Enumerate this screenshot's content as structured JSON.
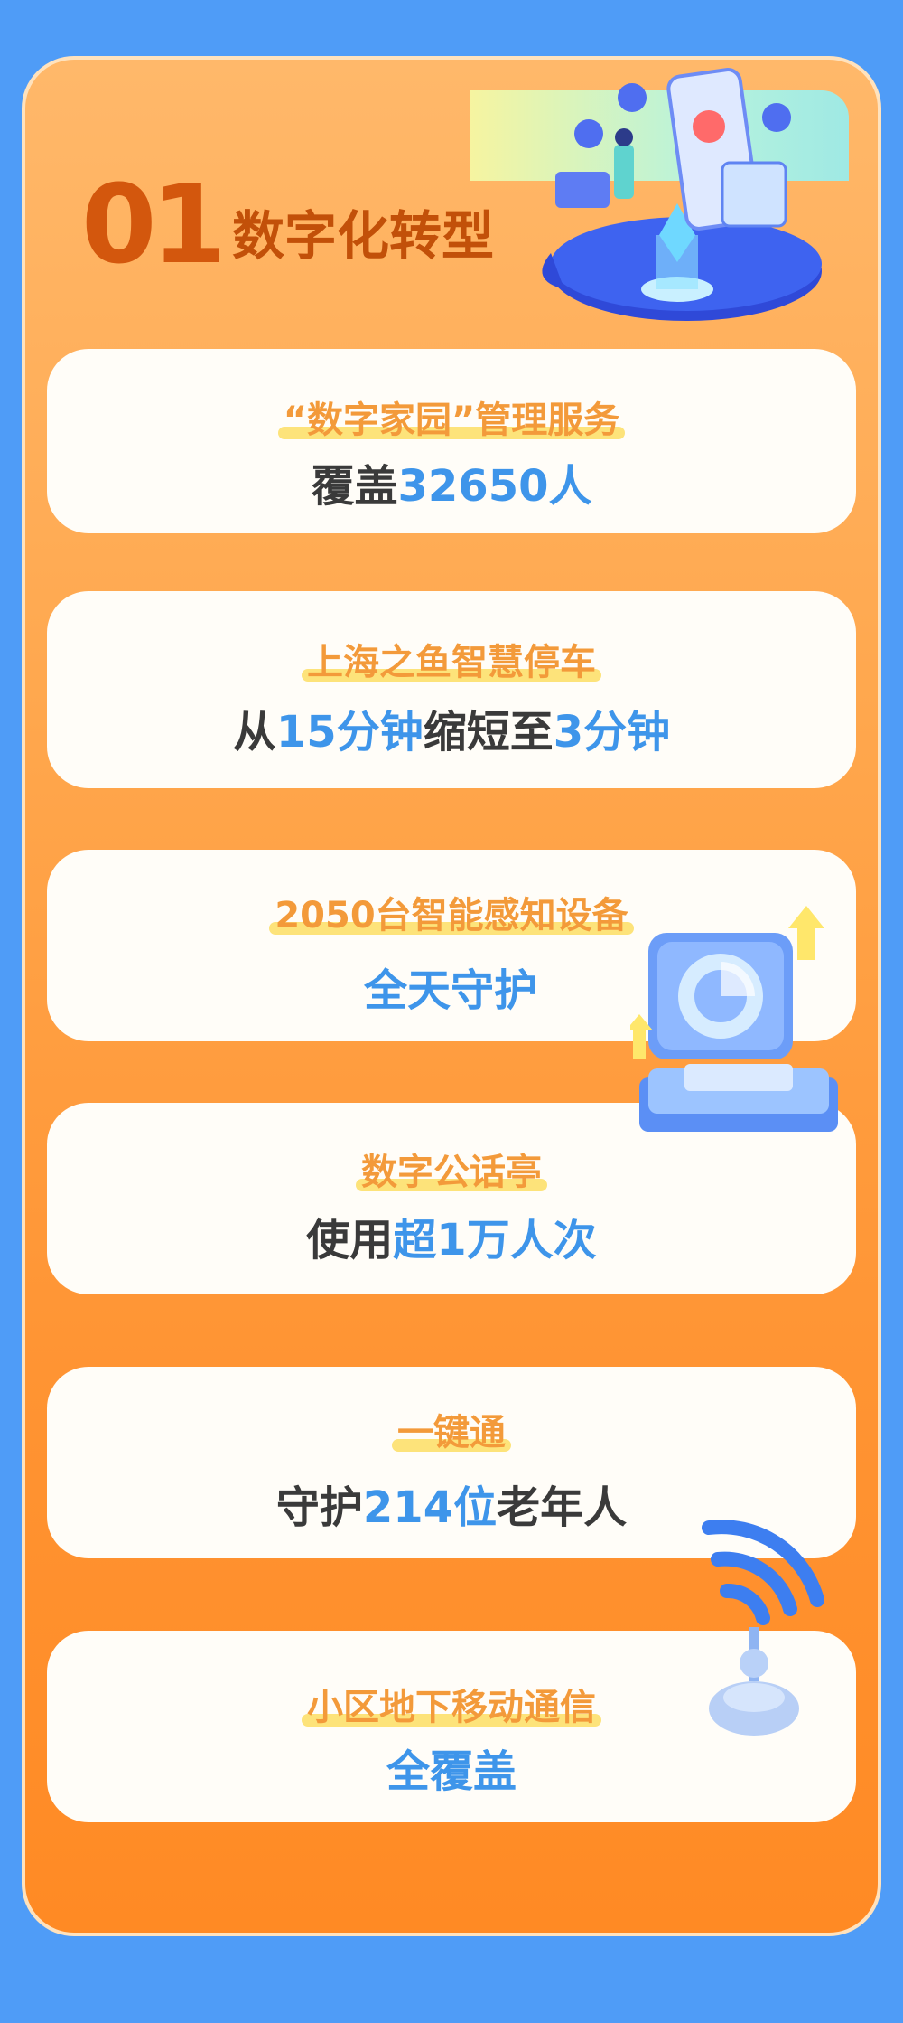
{
  "title": {
    "number": "01",
    "text": "数字化转型"
  },
  "cards": [
    {
      "head": "“数字家园”管理服务",
      "body": [
        {
          "t": "覆盖",
          "c": "dark"
        },
        {
          "t": "32650人",
          "c": "blue"
        }
      ]
    },
    {
      "head": "上海之鱼智慧停车",
      "body": [
        {
          "t": "从",
          "c": "dark"
        },
        {
          "t": "15分钟",
          "c": "blue"
        },
        {
          "t": "缩短至",
          "c": "dark"
        },
        {
          "t": "3分钟",
          "c": "blue"
        }
      ]
    },
    {
      "head": "2050台智能感知设备",
      "body": [
        {
          "t": "全天守护",
          "c": "blue"
        }
      ]
    },
    {
      "head": "数字公话亭",
      "body": [
        {
          "t": "使用",
          "c": "dark"
        },
        {
          "t": "超1万人次",
          "c": "blue"
        }
      ]
    },
    {
      "head": "一键通",
      "body": [
        {
          "t": "守护",
          "c": "dark"
        },
        {
          "t": "214位",
          "c": "blue"
        },
        {
          "t": "老年人",
          "c": "dark"
        }
      ]
    },
    {
      "head": "小区地下移动通信",
      "body": [
        {
          "t": "全覆盖",
          "c": "blue"
        }
      ]
    }
  ],
  "icons": [
    "smartphone-hologram-icon",
    "monitor-chart-icon",
    "signal-antenna-icon"
  ]
}
